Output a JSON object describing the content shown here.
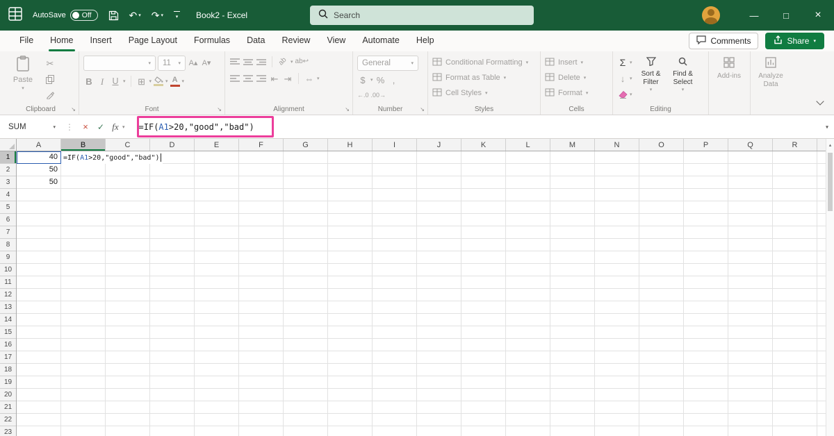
{
  "title_bar": {
    "autosave_label": "AutoSave",
    "autosave_state": "Off",
    "document_title": "Book2 - Excel",
    "search_placeholder": "Search"
  },
  "menu_bar": {
    "tabs": [
      "File",
      "Home",
      "Insert",
      "Page Layout",
      "Formulas",
      "Data",
      "Review",
      "View",
      "Automate",
      "Help"
    ],
    "active_tab": "Home",
    "comments_label": "Comments",
    "share_label": "Share"
  },
  "ribbon": {
    "clipboard": {
      "group_label": "Clipboard",
      "paste_label": "Paste"
    },
    "font": {
      "group_label": "Font",
      "size_value": "11"
    },
    "alignment": {
      "group_label": "Alignment"
    },
    "number": {
      "group_label": "Number",
      "format_value": "General"
    },
    "styles": {
      "group_label": "Styles",
      "items": [
        "Conditional Formatting",
        "Format as Table",
        "Cell Styles"
      ]
    },
    "cells": {
      "group_label": "Cells",
      "items": [
        "Insert",
        "Delete",
        "Format"
      ]
    },
    "editing": {
      "group_label": "Editing",
      "sort_filter_label": "Sort & Filter",
      "find_select_label": "Find & Select"
    },
    "addins_label": "Add-ins",
    "analyze_data_label": "Analyze Data"
  },
  "formula_bar": {
    "name_box_value": "SUM",
    "fx_label": "fx",
    "formula_full": "=IF(A1>20,\"good\",\"bad\")",
    "formula_parts": [
      {
        "text": "=IF(",
        "color": "#1B1B1B"
      },
      {
        "text": "A1",
        "color": "#2A5DB0"
      },
      {
        "text": ">20,\"good\",\"bad\")",
        "color": "#1B1B1B"
      }
    ],
    "annotation_color": "#EC3E9B"
  },
  "grid": {
    "columns": [
      "A",
      "B",
      "C",
      "D",
      "E",
      "F",
      "G",
      "H",
      "I",
      "J",
      "K",
      "L",
      "M",
      "N",
      "O",
      "P",
      "Q",
      "R"
    ],
    "rows": [
      "1",
      "2",
      "3",
      "4",
      "5",
      "6",
      "7",
      "8",
      "9",
      "10",
      "11",
      "12",
      "13",
      "14",
      "15",
      "16",
      "17",
      "18",
      "19",
      "20",
      "21",
      "22",
      "23"
    ],
    "selection": {
      "column": "B",
      "row": "1"
    },
    "reference": {
      "col": "A",
      "row": 1
    },
    "cells": [
      {
        "ref": "A1",
        "col": "A",
        "row": 1,
        "value": "40"
      },
      {
        "ref": "A2",
        "col": "A",
        "row": 2,
        "value": "50"
      },
      {
        "ref": "A3",
        "col": "A",
        "row": 3,
        "value": "50"
      }
    ],
    "edit_cell": {
      "ref": "B1",
      "col": "B",
      "row": 1,
      "parts": [
        {
          "text": "=IF(",
          "color": "#1B1B1B"
        },
        {
          "text": "A1",
          "color": "#2A5DB0"
        },
        {
          "text": ">20,\"good\",\"bad\")",
          "color": "#1B1B1B"
        }
      ]
    }
  },
  "icons": {
    "caret_down": "▾",
    "undo": "↶",
    "redo": "↷",
    "cut": "✂",
    "sum": "Σ",
    "fill_arrow": "↓",
    "percent": "%",
    "comma": ",",
    "accounting": "$",
    "increase_decimal": "←.0",
    "decrease_decimal": ".00→",
    "increase_font": "A▴",
    "decrease_font": "A▾",
    "bold": "B",
    "italic": "I",
    "underline": "U",
    "borders": "⊞",
    "orientation": "ab",
    "wrap_text": "ab↩",
    "merge": "⇔",
    "indent_decrease": "⇤",
    "indent_increase": "⇥",
    "font_color_letter": "A",
    "dots": "⋮",
    "cancel": "×",
    "enter": "✓",
    "minimize": "—",
    "maximize": "□",
    "close": "×",
    "scroll_up": "▴",
    "launcher": "↘"
  },
  "colors": {
    "titlebar_green": "#185C37",
    "accent_green": "#107C41",
    "annotation_pink": "#EC3E9B",
    "reference_blue": "#2A5DB0"
  }
}
